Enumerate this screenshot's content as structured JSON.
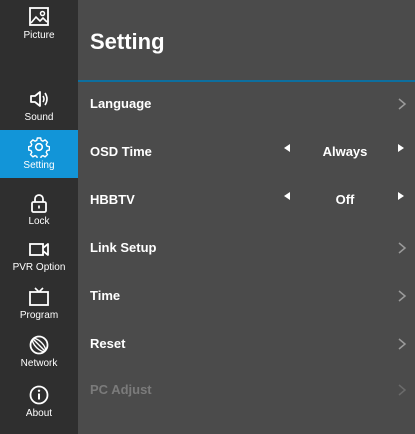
{
  "sidebar": {
    "items": [
      {
        "label": "Picture",
        "icon": "picture-icon",
        "active": false
      },
      {
        "label": "Sound",
        "icon": "speaker-icon",
        "active": false
      },
      {
        "label": "Setting",
        "icon": "gear-icon",
        "active": true
      },
      {
        "label": "Lock",
        "icon": "lock-icon",
        "active": false
      },
      {
        "label": "PVR Option",
        "icon": "video-camera-icon",
        "active": false
      },
      {
        "label": "Program",
        "icon": "tv-icon",
        "active": false
      },
      {
        "label": "Network",
        "icon": "globe-icon",
        "active": false
      },
      {
        "label": "About",
        "icon": "info-icon",
        "active": false
      }
    ]
  },
  "main": {
    "title": "Setting",
    "rows": [
      {
        "label": "Language",
        "type": "submenu",
        "enabled": true
      },
      {
        "label": "OSD Time",
        "type": "selector",
        "value": "Always",
        "enabled": true
      },
      {
        "label": "HBBTV",
        "type": "selector",
        "value": "Off",
        "enabled": true
      },
      {
        "label": "Link Setup",
        "type": "submenu",
        "enabled": true
      },
      {
        "label": "Time",
        "type": "submenu",
        "enabled": true
      },
      {
        "label": "Reset",
        "type": "submenu",
        "enabled": true
      },
      {
        "label": "PC Adjust",
        "type": "submenu",
        "enabled": false
      }
    ]
  },
  "colors": {
    "accent": "#1295d8",
    "sidebar_bg": "#2f2f2f",
    "main_bg": "#4b4b4b",
    "divider": "#0d6f9f",
    "disabled_text": "#7b7b7b"
  }
}
